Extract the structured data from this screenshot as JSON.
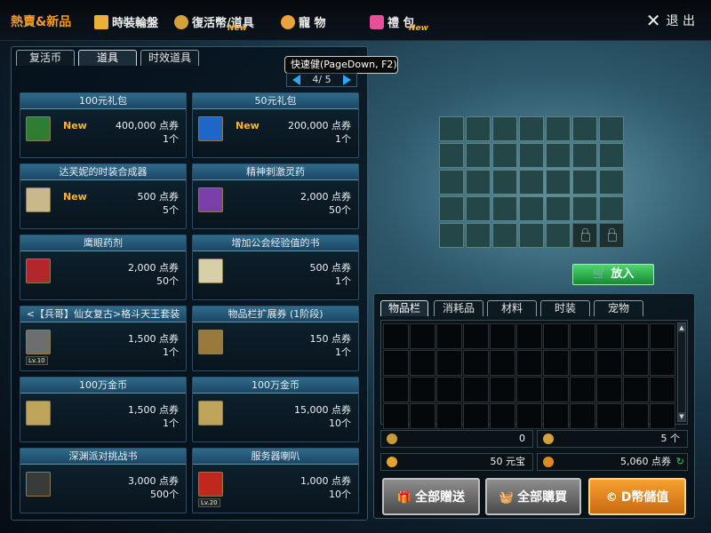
{
  "header": {
    "title": "熱賣&新品",
    "menu": [
      {
        "label": "時裝輪盤",
        "icon": "trophy-icon",
        "color": "#e9b13a"
      },
      {
        "label": "復活幣/道具",
        "icon": "coin-icon",
        "color": "#d4a23a",
        "badge": "New"
      },
      {
        "label": "寵 物",
        "icon": "paw-icon",
        "color": "#e9a33a"
      },
      {
        "label": "禮 包",
        "icon": "gift-icon",
        "color": "#e6509b",
        "badge": "New"
      }
    ],
    "exit_label": "退 出"
  },
  "shop_tabs": [
    "复活币",
    "道具",
    "时效道具"
  ],
  "active_shop_tab": 1,
  "tooltip": "快速健(PageDown, F2)",
  "pager": {
    "current": "4/ 5"
  },
  "items": [
    {
      "name": "100元礼包",
      "badge": "New",
      "price": "400,000 点券",
      "qty": "1个",
      "icon_color": "#2e7d32"
    },
    {
      "name": "50元礼包",
      "badge": "New",
      "price": "200,000 点券",
      "qty": "1个",
      "icon_color": "#1e66c8"
    },
    {
      "name": "达芙妮的时装合成器",
      "badge": "New",
      "price": "500 点券",
      "qty": "5个",
      "icon_color": "#c8b88a"
    },
    {
      "name": "精神刺激灵药",
      "badge": "",
      "price": "2,000 点券",
      "qty": "50个",
      "icon_color": "#7a3fa8"
    },
    {
      "name": "鹰眼药剂",
      "badge": "",
      "price": "2,000 点券",
      "qty": "50个",
      "icon_color": "#b3262a"
    },
    {
      "name": "增加公会经验值的书",
      "badge": "",
      "price": "500 点券",
      "qty": "1个",
      "icon_color": "#d8cfa6"
    },
    {
      "name": "<【兵哥】仙女复古>格斗天王套装",
      "badge": "",
      "price": "1,500 点券",
      "qty": "1个",
      "icon_color": "#6e6e6e",
      "level": "Lv.10"
    },
    {
      "name": "物品栏扩展券 (1阶段)",
      "badge": "",
      "price": "150 点券",
      "qty": "1个",
      "icon_color": "#9a7a3a"
    },
    {
      "name": "100万金币",
      "badge": "",
      "price": "1,500 点券",
      "qty": "1个",
      "icon_color": "#bfa55a"
    },
    {
      "name": "100万金币",
      "badge": "",
      "price": "15,000 点券",
      "qty": "10个",
      "icon_color": "#bfa55a"
    },
    {
      "name": "深渊派对挑战书",
      "badge": "",
      "price": "3,000 点券",
      "qty": "500个",
      "icon_color": "#3a3a3a"
    },
    {
      "name": "服务器喇叭",
      "badge": "",
      "price": "1,000 点券",
      "qty": "10个",
      "icon_color": "#c0281e",
      "level": "Lv.20"
    }
  ],
  "put_button": "放入",
  "inventory_tabs": [
    "物品栏",
    "消耗品",
    "材料",
    "时装",
    "宠物"
  ],
  "active_inventory_tab": 0,
  "stats": {
    "left_top": "0",
    "right_top": "5 个",
    "left_bottom": "50 元宝",
    "right_bottom": "5,060 点券"
  },
  "buttons": {
    "gift_all": "全部贈送",
    "buy_all": "全部購買",
    "recharge": "D幣儲值"
  }
}
